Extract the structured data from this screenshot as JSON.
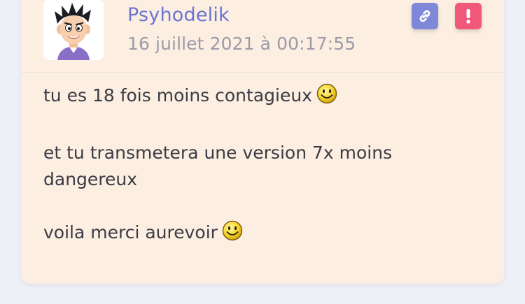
{
  "post": {
    "author": "Psyhodelik",
    "timestamp": "16 juillet 2021 à 00:17:55",
    "avatar_icon": "cartoon-boy-avatar",
    "actions": {
      "link_icon": "link-icon",
      "report_icon": "exclamation-icon"
    },
    "colors": {
      "card_background": "#fcefe2",
      "author": "#6b73d0",
      "link_button": "#7f87d8",
      "report_button": "#f0587a"
    },
    "paragraphs": [
      {
        "text": "tu es 18 fois moins contagieux",
        "emoji": "smiley-icon"
      },
      {
        "text": "et tu transmetera une version 7x moins dangereux"
      },
      {
        "text": "voila merci aurevoir",
        "emoji": "smiley-icon"
      }
    ]
  }
}
